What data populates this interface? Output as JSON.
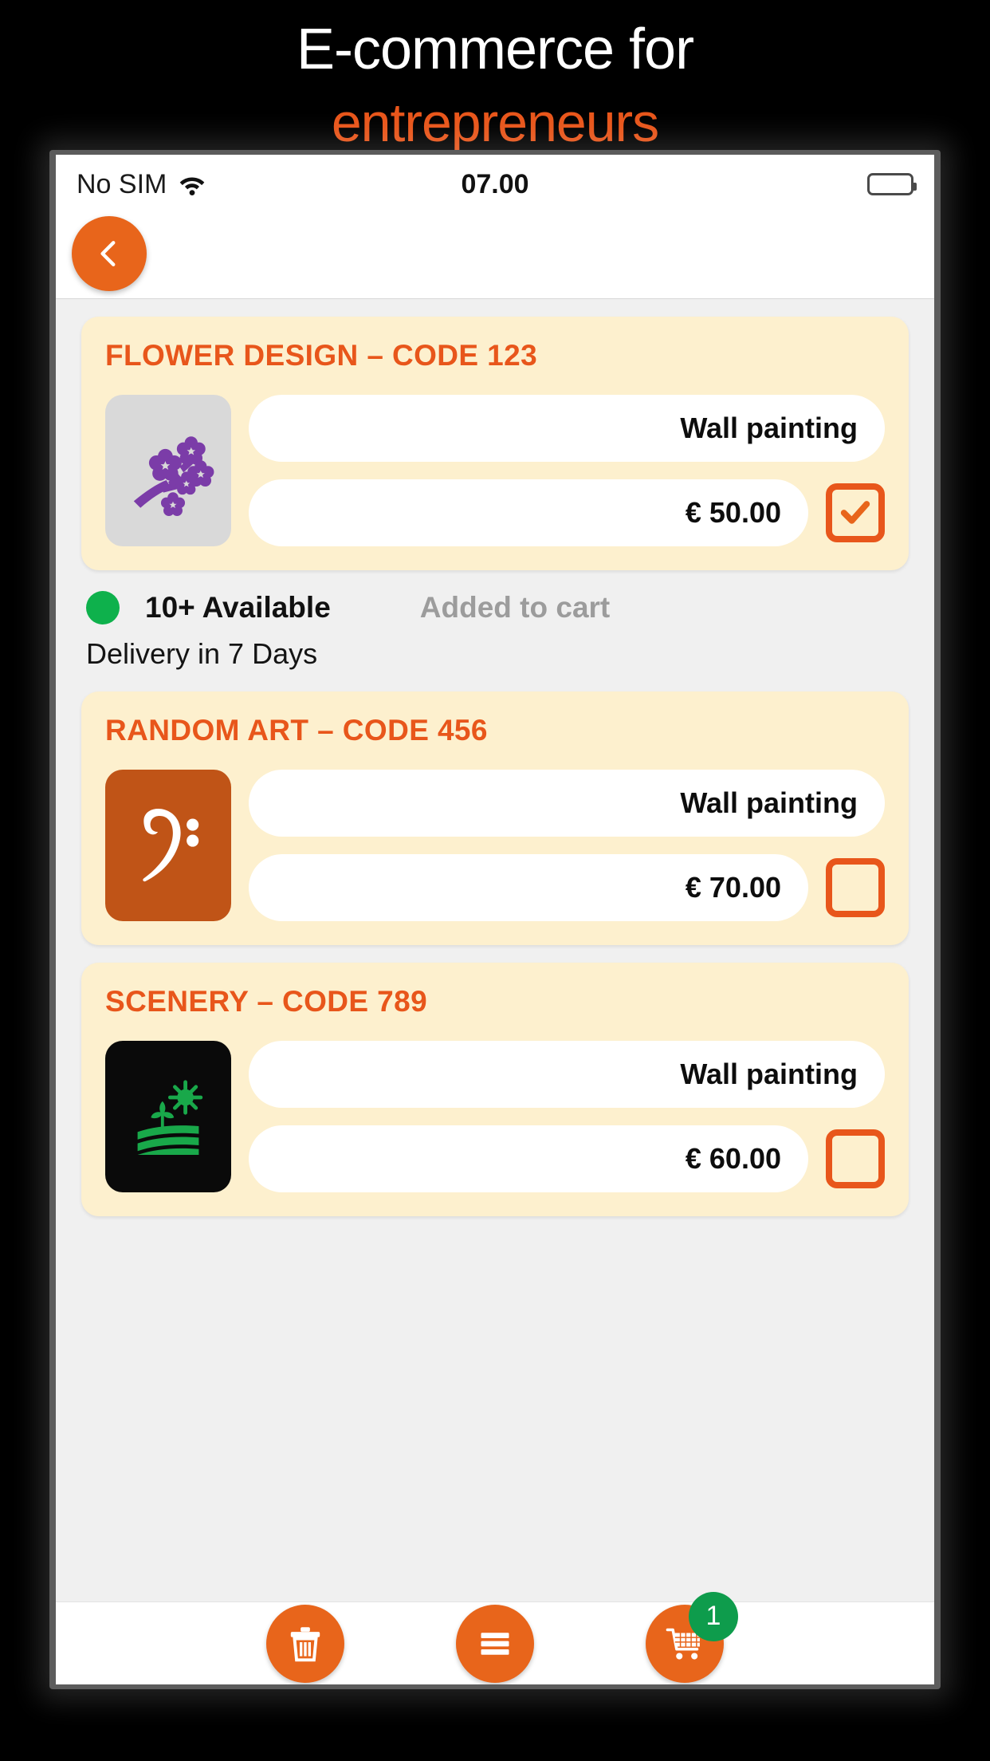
{
  "promo": {
    "line1": "E-commerce for",
    "line2": "entrepreneurs",
    "line1_color": "#FFFFFF",
    "line2_color": "#E8561B"
  },
  "statusbar": {
    "carrier": "No SIM",
    "wifi_icon": "wifi-icon",
    "time": "07.00",
    "battery_icon": "battery-icon"
  },
  "navbar": {
    "back_icon": "chevron-left-icon"
  },
  "products": [
    {
      "title": "FLOWER DESIGN – CODE 123",
      "thumb_icon": "cherry-blossom-icon",
      "thumb_bg": "#D9D9D9",
      "thumb_fg": "#7B3CA8",
      "category": "Wall painting",
      "price": "€ 50.00",
      "checked": true,
      "status": {
        "availability": "10+ Available",
        "availability_dot_color": "#0EB14C",
        "cart_state": "Added to cart",
        "delivery": "Delivery in 7 Days"
      }
    },
    {
      "title": "RANDOM ART – CODE 456",
      "thumb_icon": "bass-clef-icon",
      "thumb_bg": "#C05417",
      "thumb_fg": "#FFFFFF",
      "category": "Wall painting",
      "price": "€ 70.00",
      "checked": false,
      "status": null
    },
    {
      "title": "SCENERY – CODE 789",
      "thumb_icon": "landscape-field-icon",
      "thumb_bg": "#0A0A0A",
      "thumb_fg": "#19A84A",
      "category": "Wall painting",
      "price": "€ 60.00",
      "checked": false,
      "status": null
    }
  ],
  "tabbar": {
    "items": [
      {
        "name": "delete",
        "icon": "trash-icon"
      },
      {
        "name": "menu",
        "icon": "hamburger-menu-icon"
      },
      {
        "name": "cart",
        "icon": "shopping-cart-icon",
        "badge": "1",
        "badge_color": "#0E9C4C"
      }
    ]
  },
  "colors": {
    "accent_orange": "#E8651B",
    "title_orange": "#E8561B",
    "card_cream": "#FDF0CE",
    "page_gray": "#F0F0F0",
    "green": "#0EB14C"
  }
}
